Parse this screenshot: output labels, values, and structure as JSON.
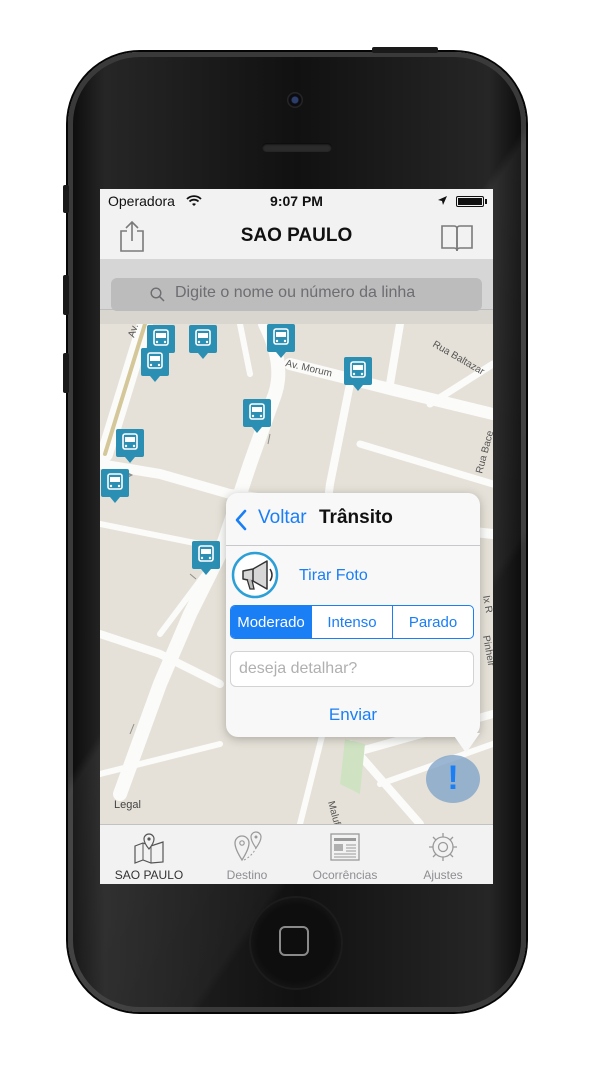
{
  "status_bar": {
    "carrier": "Operadora",
    "time": "9:07 PM"
  },
  "header": {
    "title": "SAO PAULO",
    "share_icon": "share-icon",
    "bookmarks_icon": "book-icon"
  },
  "search": {
    "placeholder": "Digite o nome ou número da linha"
  },
  "map": {
    "legal_label": "Legal",
    "street_labels": [
      "Av. Marginal Pinheiros",
      "Av. Morum",
      "Rua Baltazar",
      "Rua Bace",
      "Ix R",
      "Pinheir",
      "Maluf"
    ],
    "bus_marker_icon": "bus-stop-icon",
    "bus_marker_color": "#2b8fb3"
  },
  "popover": {
    "back_label": "Voltar",
    "title": "Trânsito",
    "photo_label": "Tirar Foto",
    "segments": [
      "Moderado",
      "Intenso",
      "Parado"
    ],
    "selected_segment": "Moderado",
    "detail_placeholder": "deseja detalhar?",
    "send_label": "Enviar",
    "accent_color": "#1a7ef5"
  },
  "alert_button": {
    "glyph": "!"
  },
  "tabs": [
    {
      "label": "SAO PAULO",
      "icon": "map-pin-icon",
      "active": true
    },
    {
      "label": "Destino",
      "icon": "destination-icon",
      "active": false
    },
    {
      "label": "Ocorrências",
      "icon": "newspaper-icon",
      "active": false
    },
    {
      "label": "Ajustes",
      "icon": "gear-icon",
      "active": false
    }
  ]
}
